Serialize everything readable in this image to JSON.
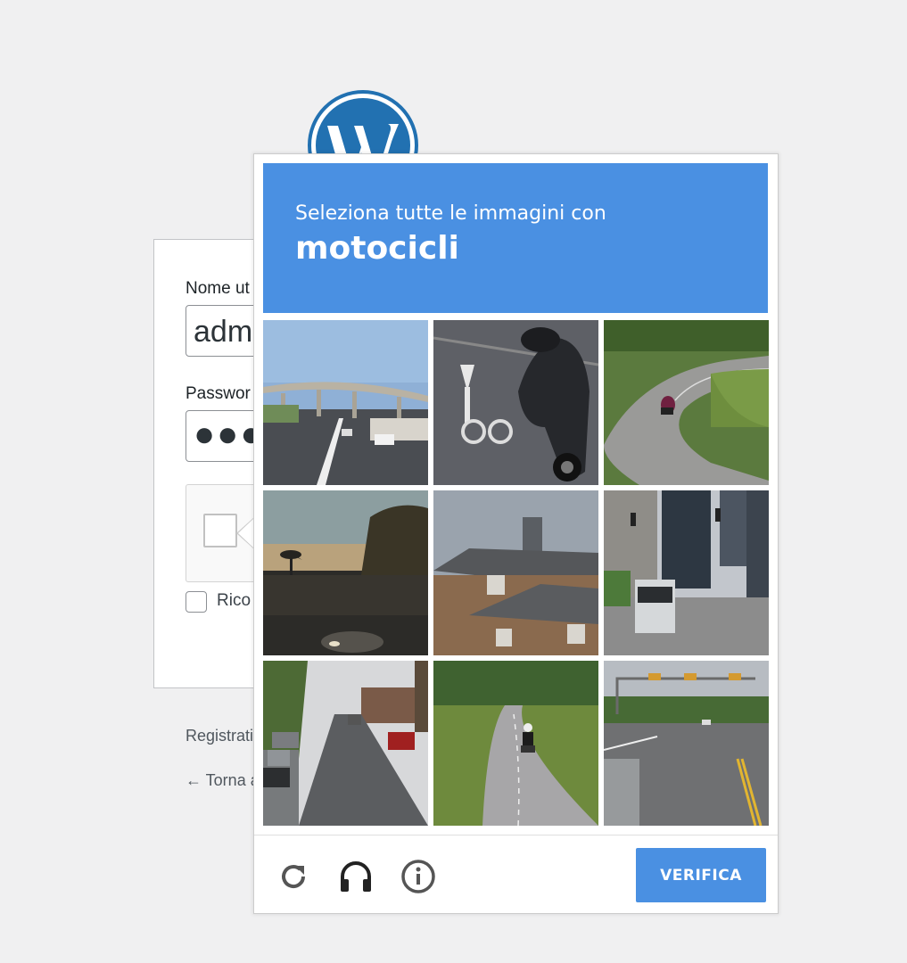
{
  "login": {
    "username_label": "Nome ut",
    "username_value": "adm",
    "password_label": "Passwor",
    "password_value": "●●●",
    "remember_label": "Rico",
    "register_link": "Registrati",
    "back_link": "← Torna a"
  },
  "challenge": {
    "instruction": "Seleziona tutte le immagini con",
    "object": "motocicli",
    "verify_label": "VERIFICA",
    "tiles": [
      "highway-overpass",
      "scooter-bike-lane",
      "motorcycle-curve",
      "dusk-wall-car",
      "house-roof",
      "city-bus-street",
      "residential-street",
      "motorcycle-path",
      "intersection"
    ],
    "accent_color": "#4a90e2"
  },
  "icons": {
    "reload": "reload-icon",
    "audio": "headphones-icon",
    "info": "info-icon",
    "logo": "wordpress-logo-icon"
  }
}
